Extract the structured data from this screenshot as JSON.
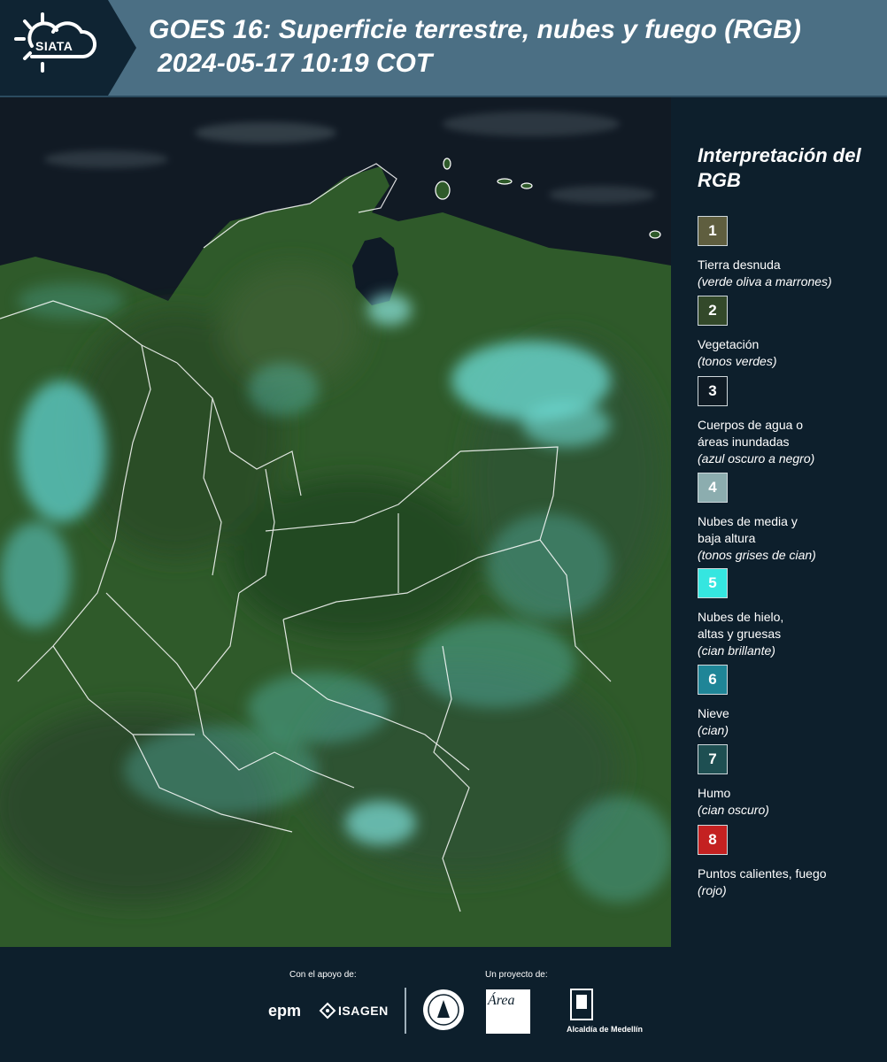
{
  "header": {
    "logo_text": "SIATA",
    "title": "GOES 16: Superficie terrestre, nubes y fuego (RGB)",
    "timestamp": "2024-05-17 10:19 COT"
  },
  "map": {
    "ocean_color": "#111a24",
    "land_color": "#2f5a2a",
    "cloud_color": "#5fd0cf",
    "border_color": "#ffffff"
  },
  "legend": {
    "title": "Interpretación del RGB",
    "items": [
      {
        "number": "1",
        "color": "#5f5e3f",
        "label": "Tierra desnuda",
        "note": "(verde oliva a marrones)"
      },
      {
        "number": "2",
        "color": "#33492a",
        "label": "Vegetación",
        "note": "(tonos verdes)"
      },
      {
        "number": "3",
        "color": "#0f1b25",
        "label": "Cuerpos de agua o\náreas inundadas",
        "note": "(azul oscuro a negro)"
      },
      {
        "number": "4",
        "color": "#8cadaf",
        "label": "Nubes de media y\nbaja altura",
        "note": "(tonos grises de cian)"
      },
      {
        "number": "5",
        "color": "#35e6e0",
        "label": "Nubes de hielo,\naltas y gruesas",
        "note": "(cian brillante)"
      },
      {
        "number": "6",
        "color": "#1f8597",
        "label": "Nieve",
        "note": "(cian)"
      },
      {
        "number": "7",
        "color": "#1e4f52",
        "label": "Humo",
        "note": "(cian oscuro)"
      },
      {
        "number": "8",
        "color": "#c42121",
        "label": "Puntos calientes, fuego",
        "note": "(rojo)"
      }
    ]
  },
  "footer": {
    "support_label": "Con el apoyo de:",
    "project_label": "Un proyecto de:",
    "epm": "epm",
    "isagen": "ISAGEN",
    "area_logo": "Área",
    "alcaldia": "Alcaldía de Medellín"
  }
}
